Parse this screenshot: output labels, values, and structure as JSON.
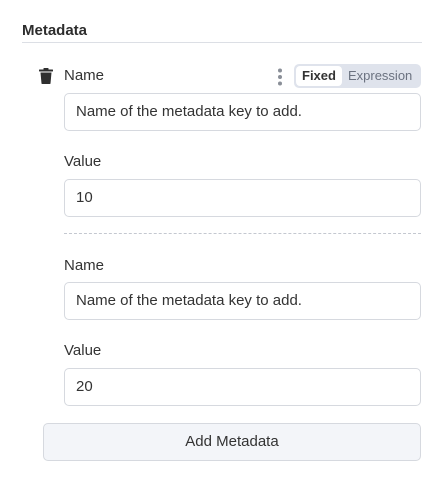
{
  "section": {
    "title": "Metadata"
  },
  "entries": [
    {
      "name_label": "Name",
      "name_value": "Name of the metadata key to add.",
      "value_label": "Value",
      "value_value": "10"
    },
    {
      "name_label": "Name",
      "name_value": "Name of the metadata key to add.",
      "value_label": "Value",
      "value_value": "20"
    }
  ],
  "mode_toggle": {
    "fixed": "Fixed",
    "expression": "Expression",
    "selected": "Fixed"
  },
  "icons": {
    "delete": "trash-icon",
    "options": "kebab-menu-icon"
  },
  "add_button": {
    "label": "Add Metadata"
  }
}
